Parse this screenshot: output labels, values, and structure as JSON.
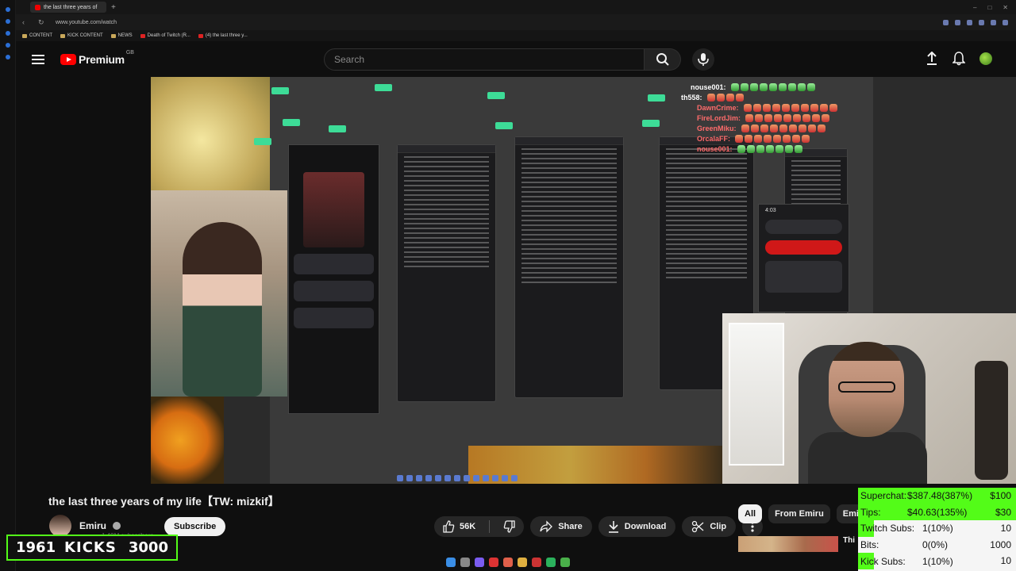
{
  "browser": {
    "tab_title": "the last three years of",
    "url": "www.youtube.com/watch",
    "bookmarks": [
      "CONTENT",
      "KICK CONTENT",
      "NEWS",
      "Death of Twitch (R...",
      "(4) the last three y..."
    ]
  },
  "header": {
    "logo_text": "Premium",
    "region": "GB",
    "search_placeholder": "Search"
  },
  "video": {
    "chat_names": [
      "nouse001:",
      "th558:",
      "DawnCrime:",
      "FireLordJim:",
      "GreenMiku:",
      "OrcalaFF:",
      "nouse001:"
    ],
    "phone_clock": "4:03"
  },
  "watch": {
    "title": "the last three years of my life【TW: mizkif】",
    "channel_name": "Emiru",
    "channel_subs": "1.49M subscribers",
    "subscribe_label": "Subscribe",
    "like_count": "56K",
    "share_label": "Share",
    "download_label": "Download",
    "clip_label": "Clip"
  },
  "sidebar": {
    "chips": [
      "All",
      "From Emiru",
      "Emiru"
    ],
    "rec_title": "Thi"
  },
  "overlay": {
    "kicks_current": "1961",
    "kicks_label": "KICKS",
    "kicks_goal": "3000",
    "stats": [
      {
        "label": "Superchat:",
        "value": "$387.48(387%)",
        "goal": "$100",
        "progress": 1.0
      },
      {
        "label": "Tips:",
        "value": "$40.63(135%)",
        "goal": "$30",
        "progress": 1.0
      },
      {
        "label": "Twitch Subs:",
        "value": "1(10%)",
        "goal": "10",
        "progress": 0.1
      },
      {
        "label": "Bits:",
        "value": "0(0%)",
        "goal": "1000",
        "progress": 0.0
      },
      {
        "label": "Kick Subs:",
        "value": "1(10%)",
        "goal": "10",
        "progress": 0.1
      }
    ]
  },
  "colors": {
    "accent_green": "#53fc18",
    "youtube_red": "#ff0000",
    "background": "#0f0f0f"
  }
}
